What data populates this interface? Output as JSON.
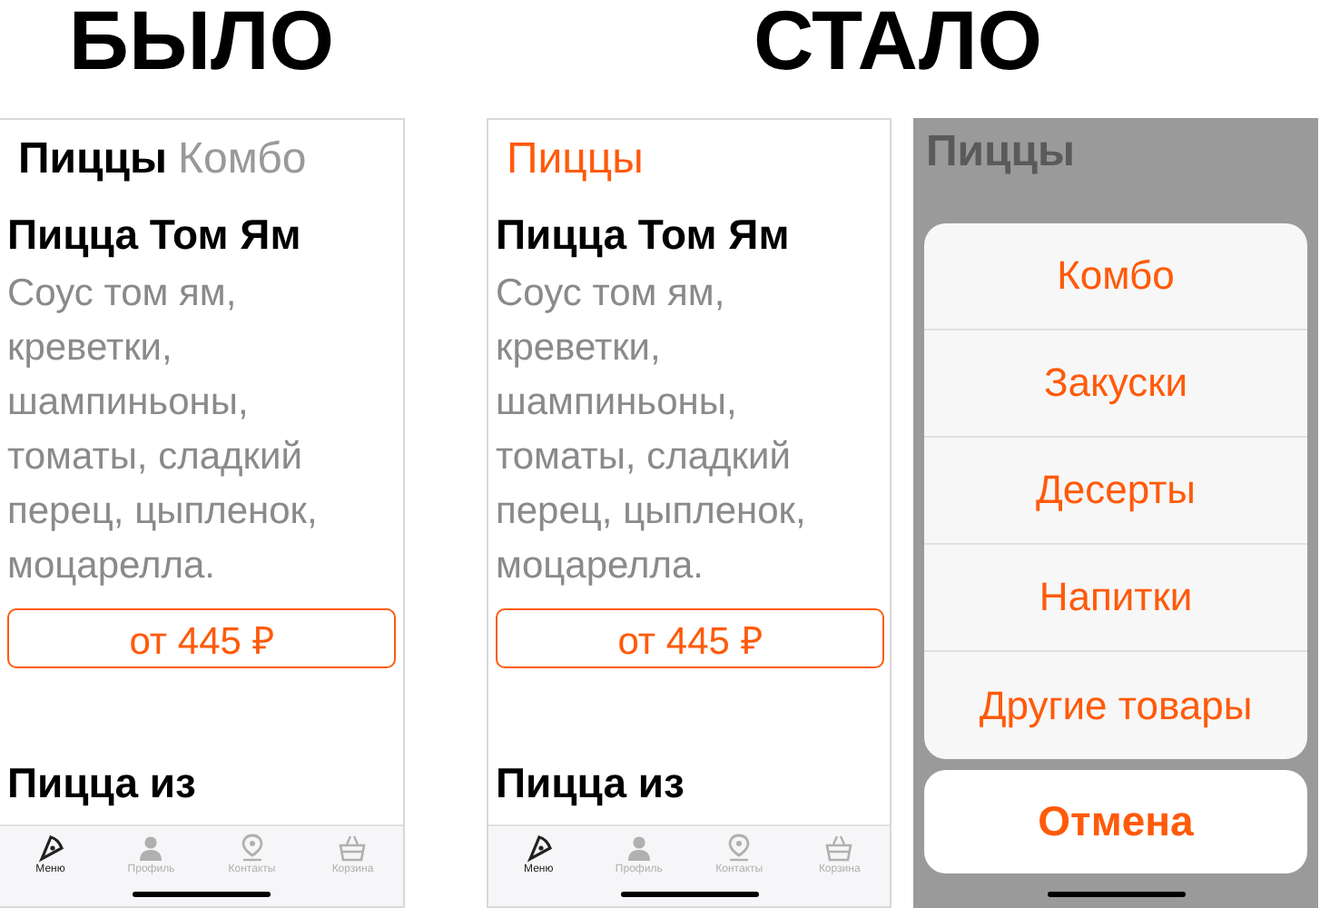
{
  "headings": [
    {
      "text": "БЫЛО"
    },
    {
      "text": "СТАЛО"
    }
  ],
  "screens": [
    {
      "kind": "tabs",
      "categories": [
        {
          "label": "Пиццы",
          "selected": true
        },
        {
          "label": "Комбо",
          "selected": false
        }
      ],
      "product": {
        "name": "Пицца Том Ям",
        "description": "Соус том ям, креветки, шампиньоны, томаты, сладкий перец, цыпленок, моцарелла.",
        "price": "от 445 ₽"
      },
      "next_product": "Пицца из",
      "tab_bar": [
        {
          "label": "Меню",
          "selected": true
        },
        {
          "label": "Профиль",
          "selected": false
        },
        {
          "label": "Контакты",
          "selected": false
        },
        {
          "label": "Корзина",
          "selected": false
        }
      ]
    },
    {
      "kind": "dropdown",
      "categories": [
        {
          "label": "Пиццы",
          "selected": true
        }
      ],
      "product": {
        "name": "Пицца Том Ям",
        "description": "Соус том ям, креветки, шампиньоны, томаты, сладкий перец, цыпленок, моцарелла.",
        "price": "от 445 ₽"
      },
      "next_product": "Пицца из",
      "tab_bar": [
        {
          "label": "Меню",
          "selected": true
        },
        {
          "label": "Профиль",
          "selected": false
        },
        {
          "label": "Контакты",
          "selected": false
        },
        {
          "label": "Корзина",
          "selected": false
        }
      ]
    },
    {
      "kind": "sheet",
      "categories": [
        {
          "label": "Пиццы",
          "selected": true
        }
      ],
      "sheet_options": [
        "Комбо",
        "Закуски",
        "Десерты",
        "Напитки",
        "Другие товары"
      ],
      "cancel": "Отмена"
    }
  ]
}
